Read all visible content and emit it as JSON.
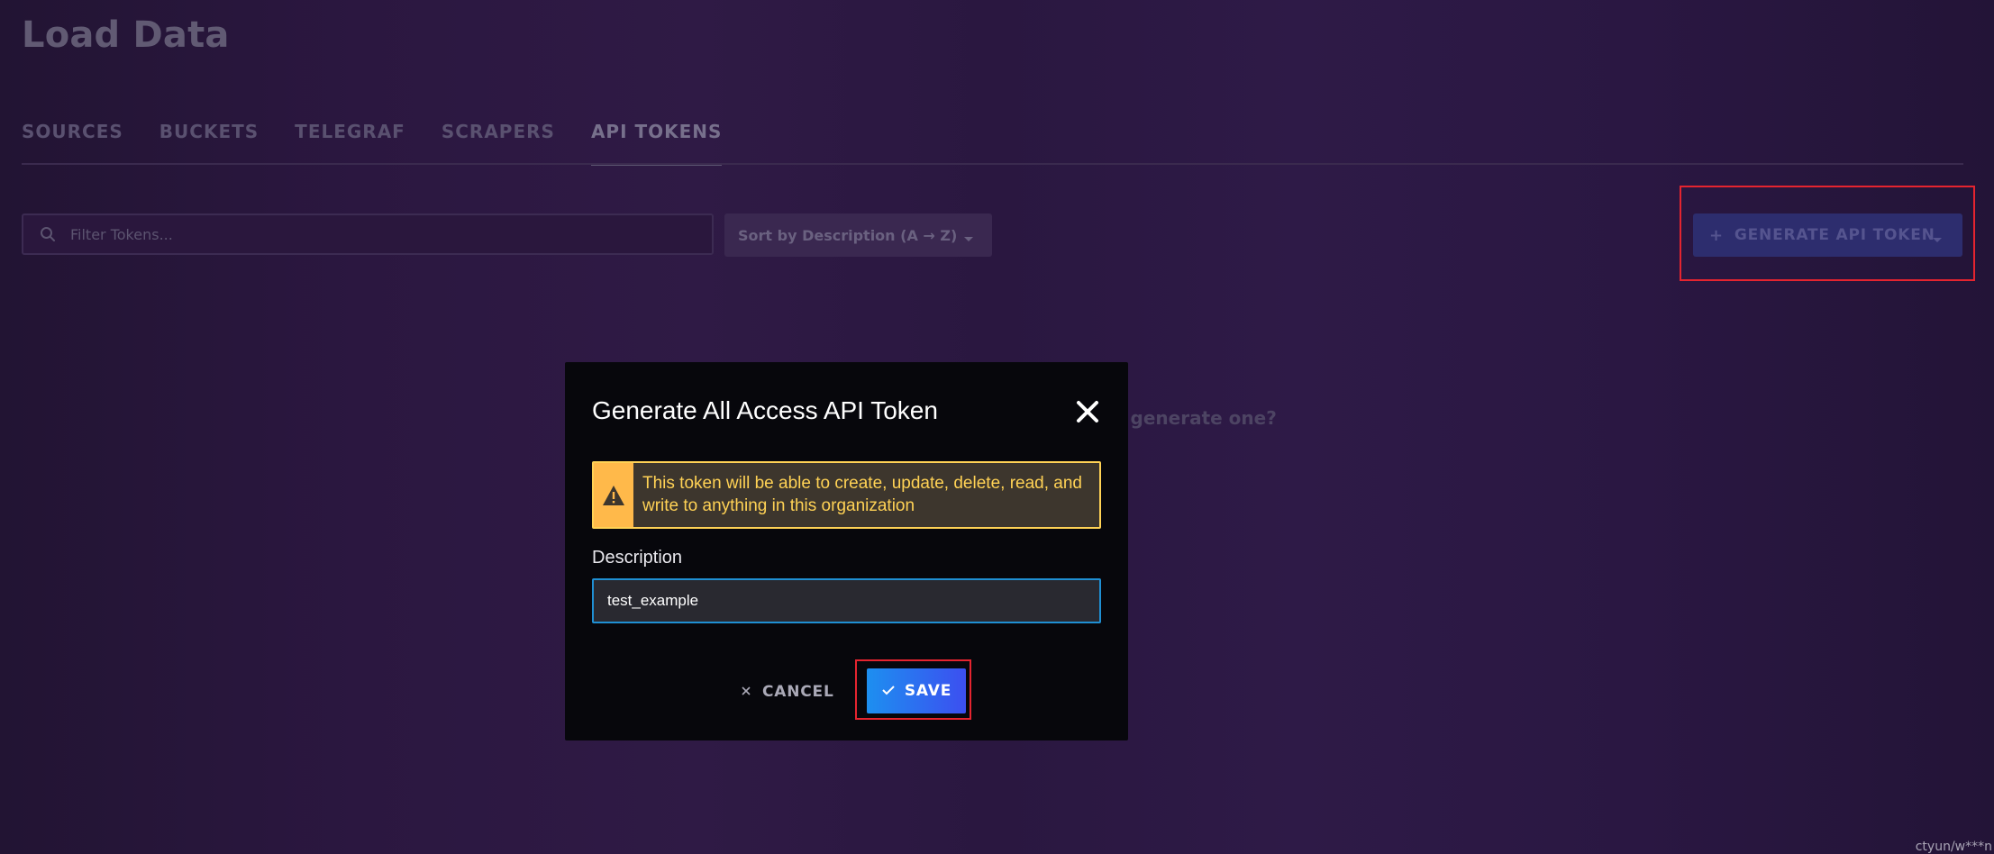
{
  "page": {
    "title": "Load Data"
  },
  "tabs": [
    {
      "label": "SOURCES",
      "active": false
    },
    {
      "label": "BUCKETS",
      "active": false
    },
    {
      "label": "TELEGRAF",
      "active": false
    },
    {
      "label": "SCRAPERS",
      "active": false
    },
    {
      "label": "API TOKENS",
      "active": true
    }
  ],
  "toolbar": {
    "filter_placeholder": "Filter Tokens...",
    "filter_icon": "search-icon",
    "sort_label": "Sort by Description (A → Z)",
    "generate_label": "GENERATE API TOKEN",
    "generate_plus": "+"
  },
  "empty_state": {
    "partial_text": "t generate one?"
  },
  "modal": {
    "title": "Generate All Access API Token",
    "close_icon": "close-icon",
    "alert_icon": "warning-icon",
    "alert_text": "This token will be able to create, update, delete, read, and write to anything in this organization",
    "description_label": "Description",
    "description_value": "test_example",
    "cancel_label": "CANCEL",
    "save_label": "SAVE"
  },
  "watermark": {
    "text": "ctyun/w***n"
  },
  "colors": {
    "alert_border": "#ffd255",
    "alert_icon_bg": "#ffb94a",
    "input_focus": "#1f8fd3",
    "save_gradient_start": "#1d8ff0",
    "save_gradient_end": "#3c4ff0",
    "highlight": "#e5242f"
  }
}
